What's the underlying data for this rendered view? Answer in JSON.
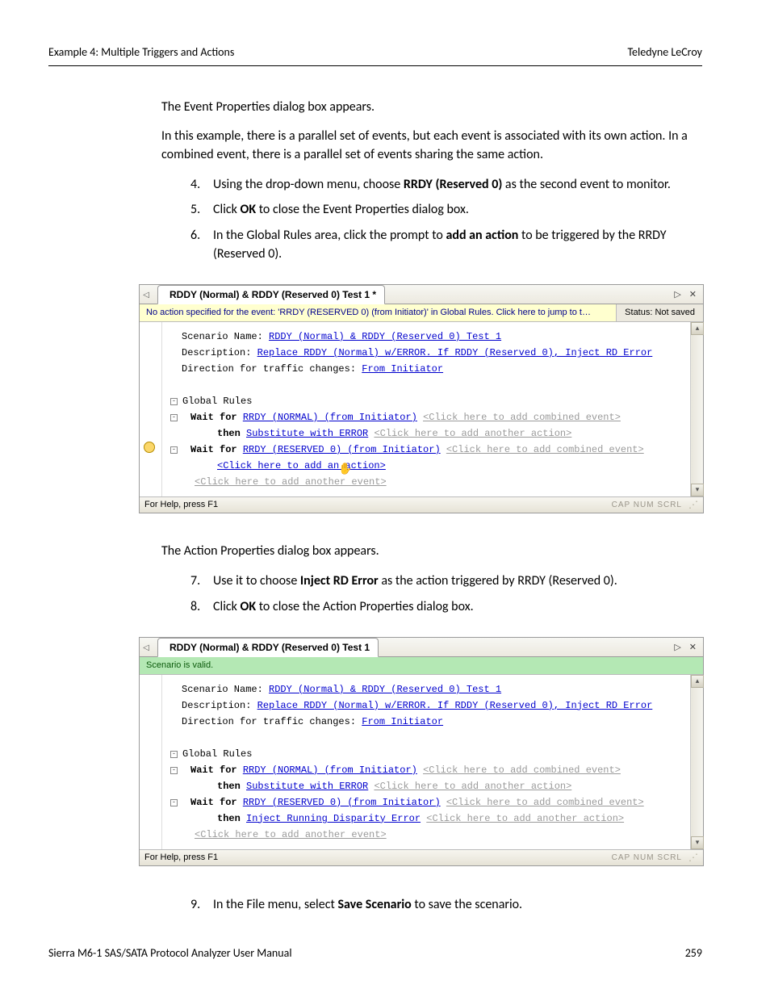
{
  "header": {
    "left": "Example 4: Multiple Triggers and Actions",
    "right": "Teledyne LeCroy"
  },
  "intro1": "The Event Properties dialog box appears.",
  "intro2": "In this example, there is a parallel set of events, but each event is associated with its own action. In a combined event, there is a parallel set of events sharing the same action.",
  "steps1": [
    {
      "n": "4.",
      "pre": "Using the drop-down menu, choose ",
      "bold": "RRDY (Reserved 0)",
      "post": " as the second event to monitor."
    },
    {
      "n": "5.",
      "pre": "Click ",
      "bold": "OK",
      "post": " to close the Event Properties dialog box."
    },
    {
      "n": "6.",
      "pre": "In the Global Rules area, click the prompt to ",
      "bold": "add an action",
      "post": " to be triggered by the RRDY (Reserved 0)."
    }
  ],
  "shot1": {
    "tab": "RDDY (Normal) & RDDY (Reserved 0) Test 1 *",
    "msg": "No action specified for the event: 'RRDY (RESERVED 0) (from Initiator)' in Global Rules.  Click here to jump to t…",
    "status": "Status: Not saved",
    "scenario_label": "Scenario Name: ",
    "scenario_link": "RDDY (Normal) & RDDY (Reserved 0) Test 1",
    "desc_label": "Description: ",
    "desc_link": "Replace RDDY (Normal) w/ERROR. If RDDY (Reserved 0), Inject RD Error",
    "dir_label": "Direction for traffic changes: ",
    "dir_link": "From Initiator",
    "global_rules": "Global Rules",
    "wait1_a": "Wait for ",
    "wait1_link": "RRDY (NORMAL) (from Initiator)",
    "add_combined": "<Click here to add combined event>",
    "then_label": "then ",
    "then_link": "Substitute with ERROR",
    "add_action": "<Click here to add another action>",
    "wait2_a": "Wait for ",
    "wait2_link": "RRDY (RESERVED 0) (from Initiator)",
    "click_add_action": "<Click here to add an action>",
    "click_add_event": "<Click here to add another event>",
    "help": "For Help, press F1",
    "caps": "CAP NUM SCRL"
  },
  "intro3": "The Action Properties dialog box appears.",
  "steps2": [
    {
      "n": "7.",
      "pre": "Use it to choose ",
      "bold": "Inject RD Error",
      "post": " as the action triggered by RRDY (Reserved 0)."
    },
    {
      "n": "8.",
      "pre": "Click ",
      "bold": "OK",
      "post": " to close the Action Properties dialog box."
    }
  ],
  "shot2": {
    "tab": "RDDY (Normal) & RDDY (Reserved 0) Test 1",
    "msg": "Scenario is valid.",
    "scenario_label": "Scenario Name: ",
    "scenario_link": "RDDY (Normal) & RDDY (Reserved 0) Test 1",
    "desc_label": "Description: ",
    "desc_link": "Replace RDDY (Normal) w/ERROR. If RDDY (Reserved 0), Inject RD Error",
    "dir_label": "Direction for traffic changes: ",
    "dir_link": "From Initiator",
    "global_rules": "Global Rules",
    "wait1_a": "Wait for ",
    "wait1_link": "RRDY (NORMAL) (from Initiator)",
    "add_combined": "<Click here to add combined event>",
    "then_label": "then ",
    "then1_link": "Substitute with ERROR",
    "add_action": "<Click here to add another action>",
    "wait2_a": "Wait for ",
    "wait2_link": "RRDY (RESERVED 0) (from Initiator)",
    "then2_link": "Inject Running Disparity Error",
    "click_add_event": "<Click here to add another event>",
    "help": "For Help, press F1",
    "caps": "CAP NUM SCRL"
  },
  "steps3": [
    {
      "n": "9.",
      "pre": "In the File menu, select ",
      "bold": "Save Scenario",
      "post": " to save the scenario."
    }
  ],
  "footer": {
    "left": "Sierra M6-1 SAS/SATA Protocol Analyzer User Manual",
    "right": "259"
  }
}
